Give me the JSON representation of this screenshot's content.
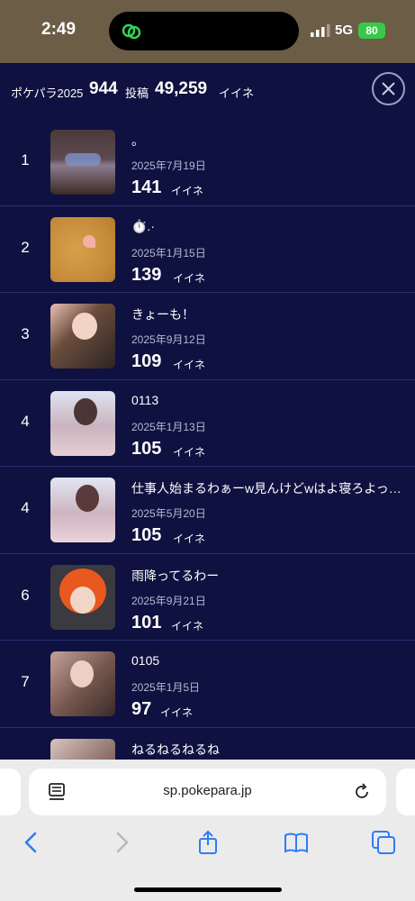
{
  "status_bar": {
    "time": "2:49",
    "network": "5G",
    "battery": "80"
  },
  "header": {
    "app_name": "ポケパラ2025",
    "post_count": "944",
    "post_unit": "投稿",
    "like_total": "49,259",
    "like_unit": "イイネ"
  },
  "posts": [
    {
      "rank": "1",
      "title": "。",
      "date": "2025年7月19日",
      "likes": "141",
      "unit": "イイネ"
    },
    {
      "rank": "2",
      "title": "⏱️.·",
      "date": "2025年1月15日",
      "likes": "139",
      "unit": "イイネ"
    },
    {
      "rank": "3",
      "title": "きょーも！",
      "date": "2025年9月12日",
      "likes": "109",
      "unit": "イイネ"
    },
    {
      "rank": "4",
      "title": "0113",
      "date": "2025年1月13日",
      "likes": "105",
      "unit": "イイネ"
    },
    {
      "rank": "4",
      "title": "仕事人始まるわぁーw見んけどwはよ寝ろよっ…",
      "date": "2025年5月20日",
      "likes": "105",
      "unit": "イイネ"
    },
    {
      "rank": "6",
      "title": "雨降ってるわー",
      "date": "2025年9月21日",
      "likes": "101",
      "unit": "イイネ"
    },
    {
      "rank": "7",
      "title": "0105",
      "date": "2025年1月5日",
      "likes": "97",
      "unit": "イイネ"
    },
    {
      "rank": "",
      "title": "ねるねるねるね",
      "date": "",
      "likes": "",
      "unit": ""
    }
  ],
  "browser": {
    "url": "sp.pokepara.jp"
  },
  "colors": {
    "background": "#0f1140",
    "status_bar": "#6b5d46",
    "battery": "#38c94a",
    "nav_icon": "#2f7cf6"
  }
}
